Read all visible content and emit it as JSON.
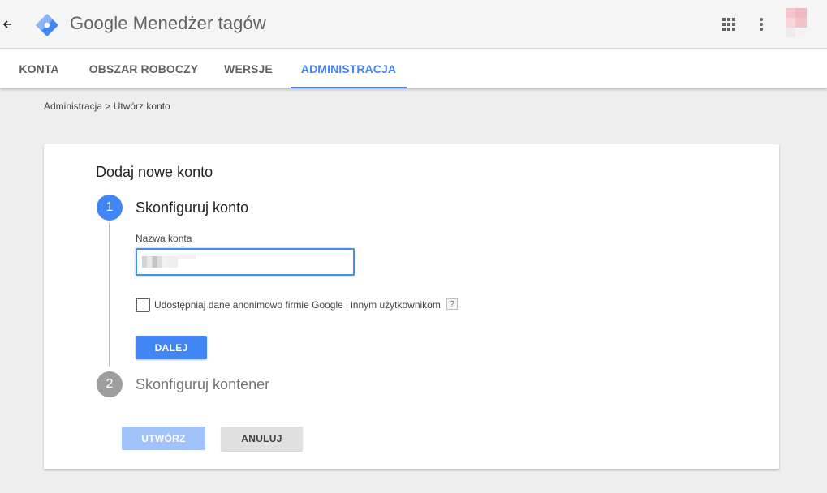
{
  "header": {
    "app_title": "Google Menedżer tagów",
    "logo_icon": "gtm-diamond-logo-icon",
    "apps_icon": "apps-grid-icon",
    "more_icon": "more-vert-icon",
    "brand_blue": "#4285f4"
  },
  "tabs": [
    {
      "label": "KONTA",
      "active": false
    },
    {
      "label": "OBSZAR ROBOCZY",
      "active": false
    },
    {
      "label": "WERSJE",
      "active": false
    },
    {
      "label": "ADMINISTRACJA",
      "active": true
    }
  ],
  "breadcrumb": "Administracja > Utwórz konto",
  "card": {
    "title": "Dodaj nowe konto",
    "step1": {
      "number": "1",
      "title": "Skonfiguruj konto"
    },
    "account_name_label": "Nazwa konta",
    "account_name_value": "",
    "share_label": "Udostępniaj dane anonimowo firmie Google i innym użytkownikom",
    "share_checked": false,
    "help_label": "?",
    "next_label": "DALEJ",
    "step2": {
      "number": "2",
      "title": "Skonfiguruj kontener"
    }
  },
  "actions": {
    "create_label": "UTWÓRZ",
    "cancel_label": "ANULUJ"
  }
}
